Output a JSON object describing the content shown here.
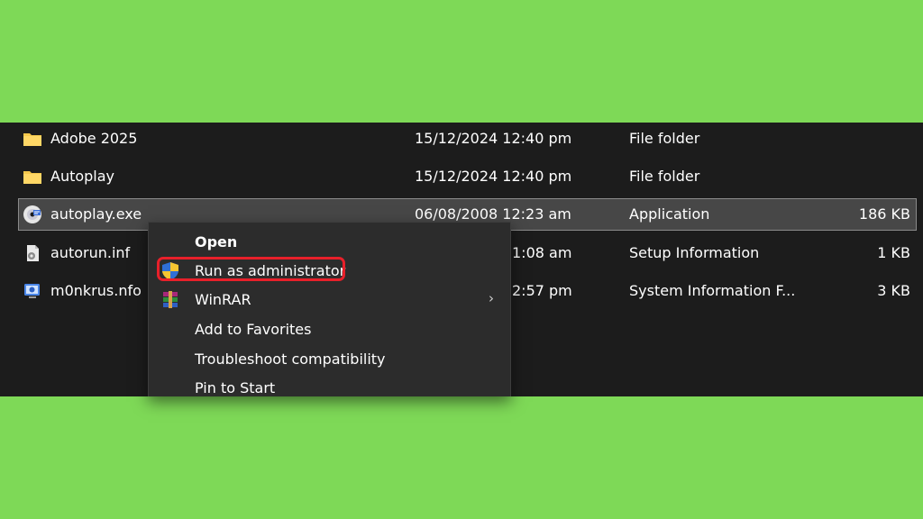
{
  "files": [
    {
      "name": "Adobe 2025",
      "date": "15/12/2024 12:40 pm",
      "type": "File folder",
      "size": "",
      "icon": "folder-icon"
    },
    {
      "name": "Autoplay",
      "date": "15/12/2024 12:40 pm",
      "type": "File folder",
      "size": "",
      "icon": "folder-icon"
    },
    {
      "name": "autoplay.exe",
      "date": "06/08/2008 12:23 am",
      "type": "Application",
      "size": "186 KB",
      "icon": "application-icon"
    },
    {
      "name": "autorun.inf",
      "date": "1:08 am",
      "type": "Setup Information",
      "size": "1 KB",
      "icon": "setup-file-icon"
    },
    {
      "name": "m0nkrus.nfo",
      "date": "2:57 pm",
      "type": "System Information F...",
      "size": "3 KB",
      "icon": "system-info-icon"
    }
  ],
  "context_menu": {
    "items": [
      {
        "label": "Open",
        "icon": ""
      },
      {
        "label": "Run as administrator",
        "icon": "uac-shield-icon"
      },
      {
        "label": "WinRAR",
        "icon": "winrar-icon",
        "submenu": true
      },
      {
        "label": "Add to Favorites",
        "icon": ""
      },
      {
        "label": "Troubleshoot compatibility",
        "icon": ""
      },
      {
        "label": "Pin to Start",
        "icon": ""
      }
    ]
  },
  "colors": {
    "background": "#7ed957",
    "explorer_bg": "#1c1c1c",
    "menu_bg": "#2c2c2c",
    "highlight": "#e8202a",
    "folder": "#f5c84c"
  }
}
